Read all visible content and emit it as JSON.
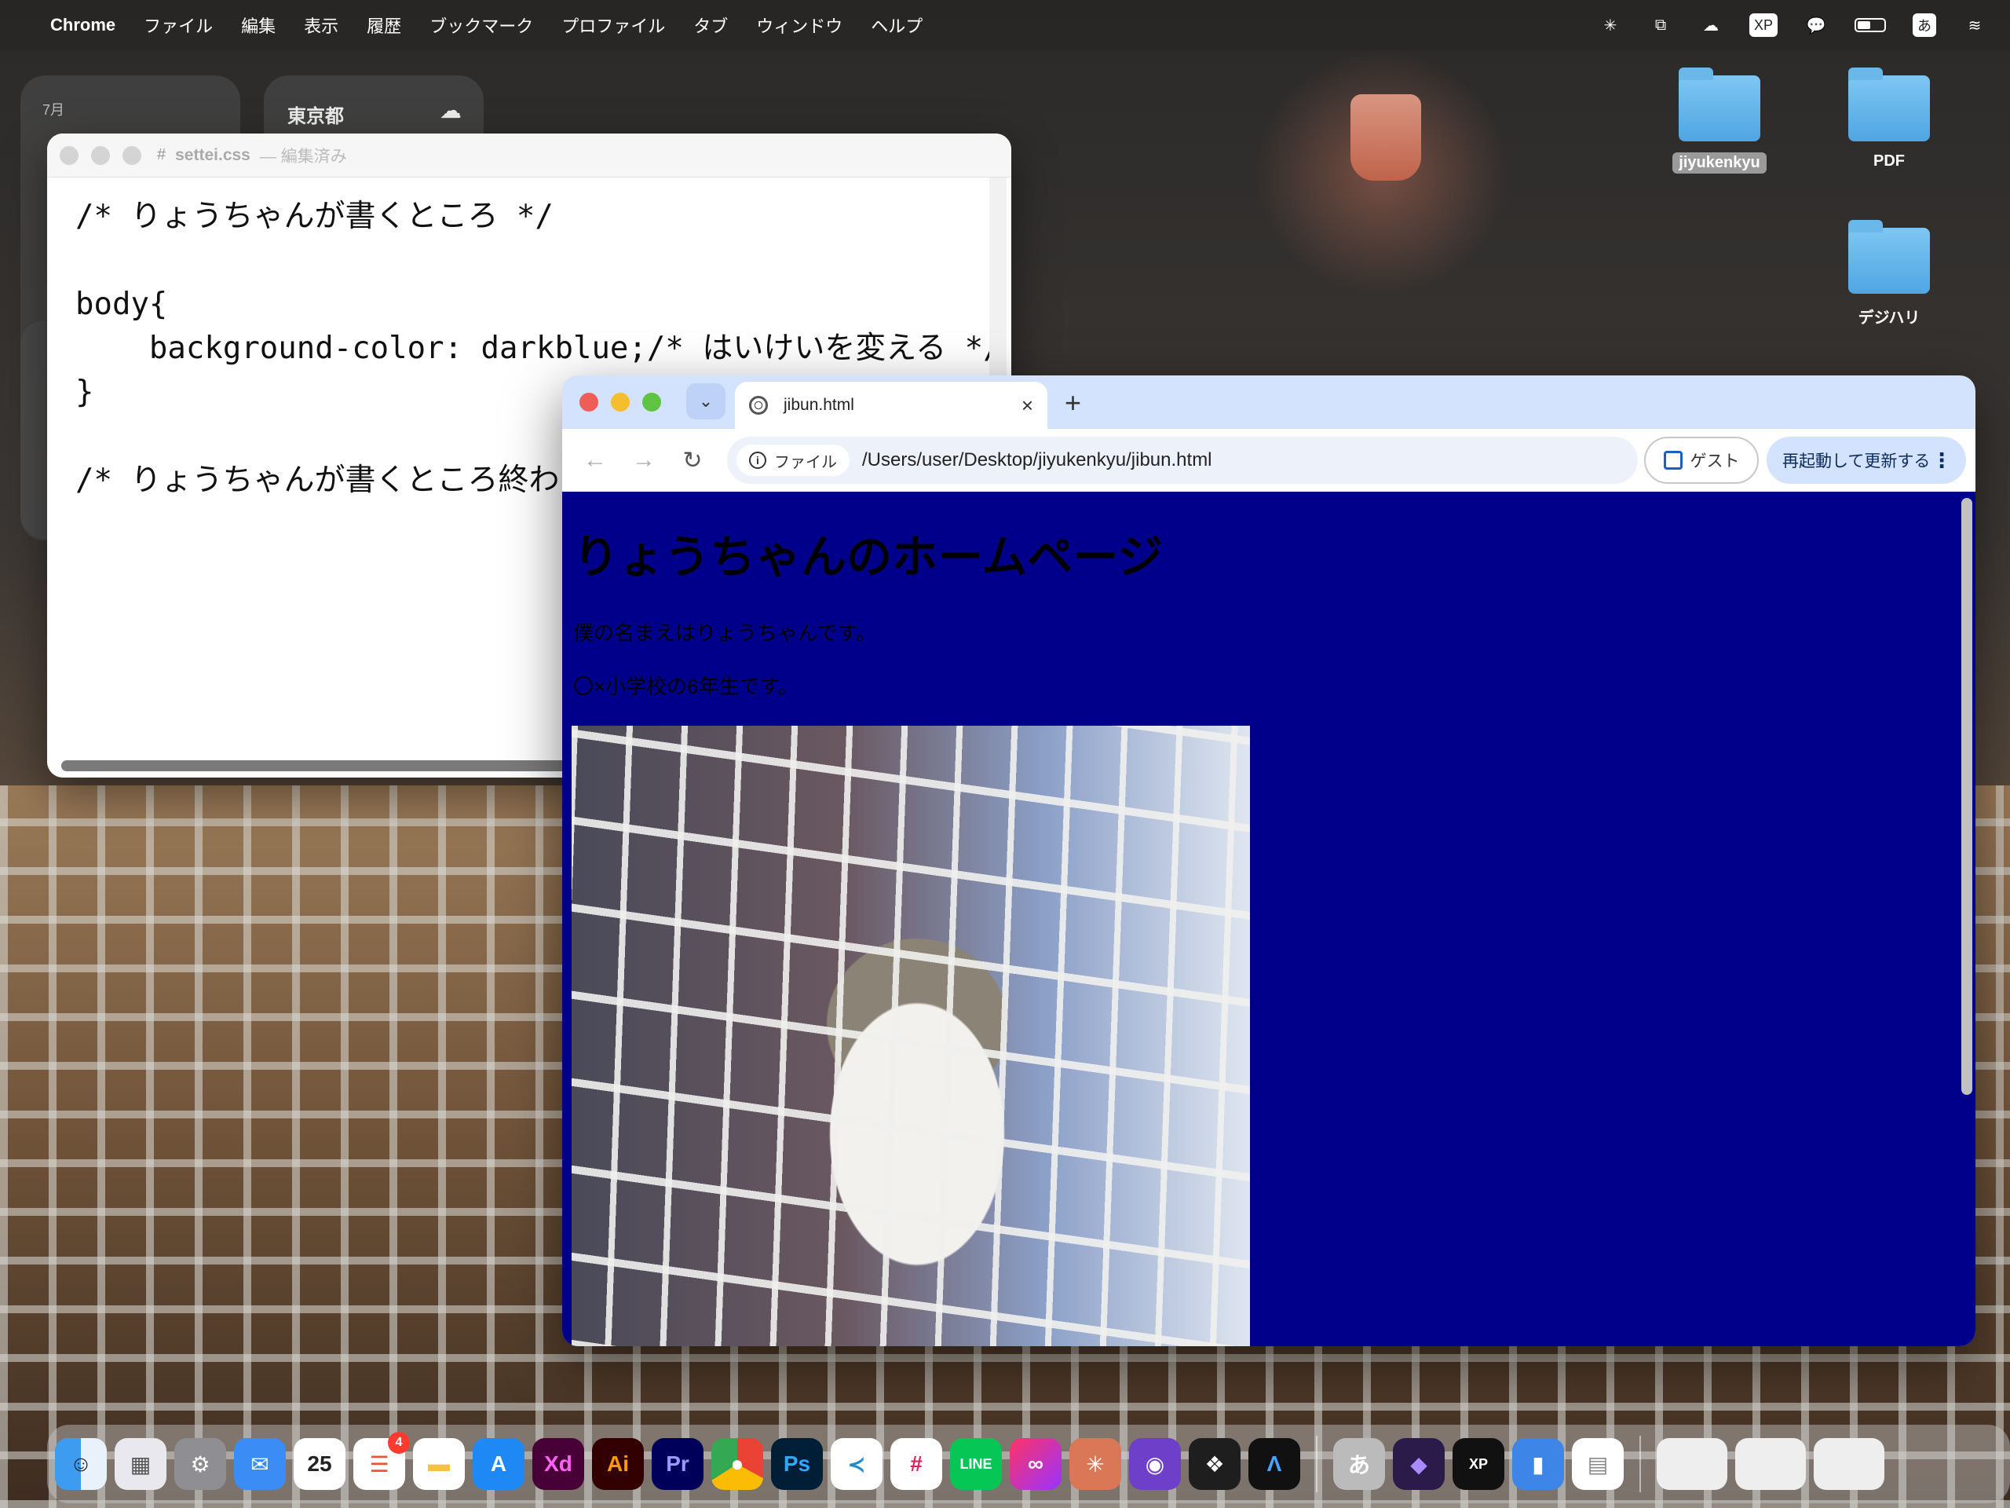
{
  "menubar": {
    "app_name": "Chrome",
    "items": [
      "ファイル",
      "編集",
      "表示",
      "履歴",
      "ブックマーク",
      "プロファイル",
      "タブ",
      "ウィンドウ",
      "ヘルプ"
    ],
    "input_method": "あ"
  },
  "widgets": {
    "calendar_month": "7月",
    "weather_city": "東京都"
  },
  "desktop_icons": [
    {
      "label": "jiyukenkyu",
      "selected": true
    },
    {
      "label": "PDF"
    },
    {
      "label": "デジハリ"
    }
  ],
  "editor": {
    "filename": "settei.css",
    "status": "— 編集済み",
    "code": "/* りょうちゃんが書くところ */\n\nbody{\n    background-color: darkblue;/* はいけいを変える */\n}\n\n/* りょうちゃんが書くところ終わり */"
  },
  "chrome": {
    "tab_title": "jibun.html",
    "site_chip": "ファイル",
    "url": "/Users/user/Desktop/jiyukenkyu/jibun.html",
    "guest_label": "ゲスト",
    "update_label": "再起動して更新する",
    "colors": {
      "page_background": "#00008b"
    }
  },
  "page": {
    "heading": "りょうちゃんのホームページ",
    "para1": "僕の名まえはりょうちゃんです。",
    "para2": "〇×小学校の6年生です。"
  },
  "dock": {
    "calendar_day": "25",
    "reminders_badge": "4",
    "apps": [
      "Finder",
      "Launchpad",
      "System Settings",
      "Mail",
      "Calendar",
      "Reminders",
      "Notes",
      "App Store",
      "Xd",
      "Ai",
      "Pr",
      "Chrome",
      "Ps",
      "VS Code",
      "Slack",
      "LINE",
      "Creative Cloud",
      "Claude",
      "GitHub Desktop",
      "Figma",
      "Affinity",
      "Input",
      "Obsidian",
      "XP-Pen",
      "Jar",
      "Table"
    ]
  }
}
